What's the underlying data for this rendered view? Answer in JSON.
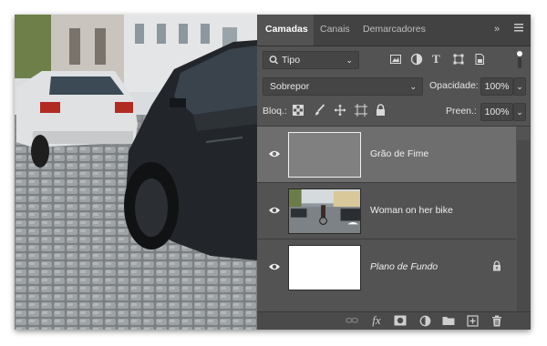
{
  "tabs": [
    {
      "label": "Camadas",
      "active": true
    },
    {
      "label": "Canais",
      "active": false
    },
    {
      "label": "Demarcadores",
      "active": false
    }
  ],
  "filter": {
    "kind_label": "Tipo"
  },
  "blend": {
    "mode": "Sobrepor",
    "opacity_label": "Opacidade:",
    "opacity_value": "100%"
  },
  "lock": {
    "label": "Bloq.:",
    "fill_label": "Preen.:",
    "fill_value": "100%"
  },
  "layers": [
    {
      "name": "Grão de Fime",
      "selected": true,
      "visible": true
    },
    {
      "name": "Woman on her bike",
      "selected": false,
      "visible": true
    },
    {
      "name": "Plano de Fundo",
      "selected": false,
      "visible": true,
      "locked": true,
      "italic": true
    }
  ],
  "colors": {
    "panel_bg": "#535353",
    "tab_bg": "#424242",
    "selected_layer": "#6e6e6e",
    "gray_fill": "#808080"
  }
}
